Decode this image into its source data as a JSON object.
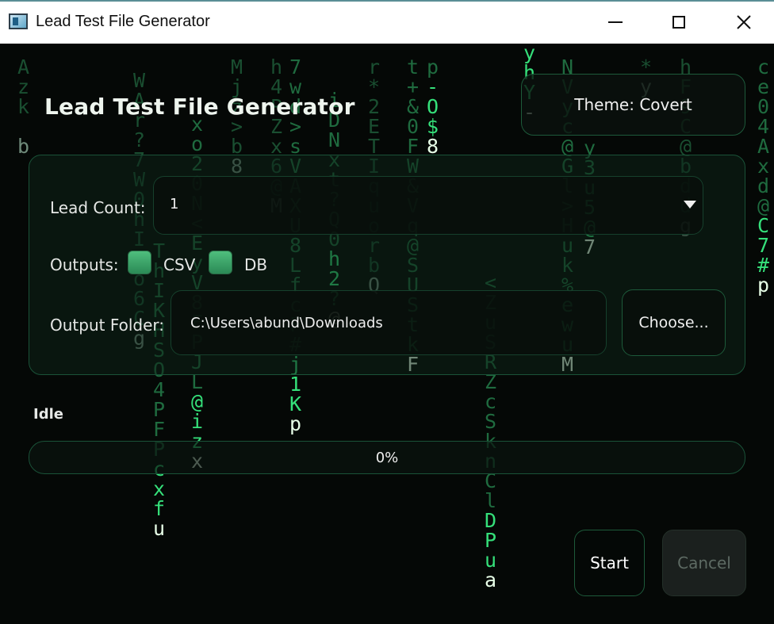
{
  "window": {
    "title": "Lead Test File Generator",
    "icon": "app-window-icon"
  },
  "app": {
    "heading": "Lead Test File Generator",
    "theme_button": "Theme: Covert"
  },
  "settings": {
    "lead_count": {
      "label": "Lead Count:",
      "value": "1"
    },
    "outputs": {
      "label": "Outputs:",
      "options": [
        {
          "label": "CSV",
          "checked": true
        },
        {
          "label": "DB",
          "checked": true
        }
      ]
    },
    "output_folder": {
      "label": "Output Folder:",
      "value": "C:\\Users\\abund\\Downloads",
      "choose_button": "Choose..."
    }
  },
  "status": {
    "text": "Idle"
  },
  "progress": {
    "value": 0,
    "label": "0%"
  },
  "actions": {
    "start": "Start",
    "cancel": "Cancel",
    "cancel_enabled": false
  },
  "colors": {
    "accent": "#2b8a56",
    "rain_bright": "#35e07a",
    "rain_dim": "#1a4f31",
    "rain_head": "#e8ffe8",
    "background": "#050806"
  },
  "rain_columns": [
    {
      "chars": "Azk b",
      "bright": false
    },
    {
      "chars": "WAr?7W0hI>o6Cg",
      "bright": false
    },
    {
      "chars": "ThIKHSO4PFPcxfu",
      "bright": true
    },
    {
      "chars": "xo20N<EyV8FPJL@izx",
      "bright": true
    },
    {
      "chars": "Mjz>b8",
      "bright": false
    },
    {
      "chars": "h4PZx6@M",
      "bright": false
    },
    {
      "chars": "7wd>sVAXU8LfcF#j1Kp",
      "bright": true
    },
    {
      "chars": "iDNxt?Q0h2?@",
      "bright": true
    },
    {
      "chars": "r*2ETIquorbQ",
      "bright": false
    },
    {
      "chars": "t+&0FW&Vq@SUStkF",
      "bright": true
    },
    {
      "chars": "p-O$8",
      "bright": true
    },
    {
      "chars": "<ZuSRZcSknClDPua",
      "bright": true
    },
    {
      "chars": "yhY-",
      "bright": true
    },
    {
      "chars": "NVyc@Gl>Huk%ewuM",
      "bright": true
    },
    {
      "chars": "y3u5@7",
      "bright": true
    },
    {
      "chars": "*y",
      "bright": false
    },
    {
      "chars": "hF9C@bddg",
      "bright": false
    },
    {
      "chars": "ce04Axd@C7#p",
      "bright": true
    }
  ]
}
